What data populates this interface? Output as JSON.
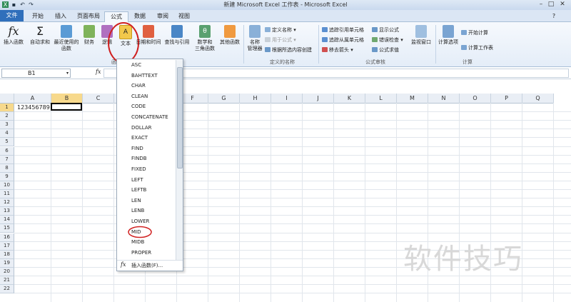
{
  "window": {
    "title": "新建 Microsoft Excel 工作表 - Microsoft Excel"
  },
  "tabs": [
    {
      "label": "文件",
      "style": "file"
    },
    {
      "label": "开始"
    },
    {
      "label": "插入"
    },
    {
      "label": "页面布局"
    },
    {
      "label": "公式",
      "active": true
    },
    {
      "label": "数据"
    },
    {
      "label": "审阅"
    },
    {
      "label": "视图"
    }
  ],
  "ribbon": {
    "insert_function": "插入函数",
    "autosum": "自动求和",
    "recent": "最近使用的\n函数",
    "financial": "财务",
    "logical": "逻辑",
    "text": "文本",
    "datetime": "日期和时间",
    "lookup": "查找与引用",
    "math": "数学和\n三角函数",
    "more": "其他函数",
    "name_manager": "名称\n管理器",
    "define_name": "定义名称",
    "use_in_formula": "用于公式",
    "create_from_selection": "根据所选内容创建",
    "group_defined_names": "定义的名称",
    "trace_precedents": "追踪引用单元格",
    "trace_dependents": "追踪从属单元格",
    "remove_arrows": "移去箭头",
    "show_formulas": "显示公式",
    "error_checking": "错误检查",
    "evaluate_formula": "公式求值",
    "group_auditing": "公式审核",
    "watch_window": "监视窗口",
    "calc_options": "计算选项",
    "calc_now": "开始计算",
    "calc_sheet": "计算工作表",
    "group_calculation": "计算",
    "group_function_library": "函"
  },
  "formula_bar": {
    "name_box": "B1",
    "fx": "fx"
  },
  "sheet": {
    "columns": [
      "A",
      "B",
      "C",
      "D",
      "E",
      "F",
      "G",
      "H",
      "I",
      "J",
      "K",
      "L",
      "M",
      "N",
      "O",
      "P",
      "Q"
    ],
    "rows": [
      "1",
      "2",
      "3",
      "4",
      "5",
      "6",
      "7",
      "8",
      "9",
      "10",
      "11",
      "12",
      "13",
      "14",
      "15",
      "16",
      "17",
      "18",
      "19",
      "20",
      "21",
      "22"
    ],
    "a1_value": "123456789"
  },
  "dropdown": {
    "items": [
      "ASC",
      "BAHTTEXT",
      "CHAR",
      "CLEAN",
      "CODE",
      "CONCATENATE",
      "DOLLAR",
      "EXACT",
      "FIND",
      "FINDB",
      "FIXED",
      "LEFT",
      "LEFTB",
      "LEN",
      "LENB",
      "LOWER",
      "MID",
      "MIDB",
      "PROPER"
    ],
    "footer": "插入函数(F)...",
    "footer_icon": "fx"
  },
  "watermark": "软件技巧",
  "colors": {
    "accent": "#2f6fbb",
    "highlight_circle": "#d02020",
    "text_icon": "#f2c84b"
  }
}
